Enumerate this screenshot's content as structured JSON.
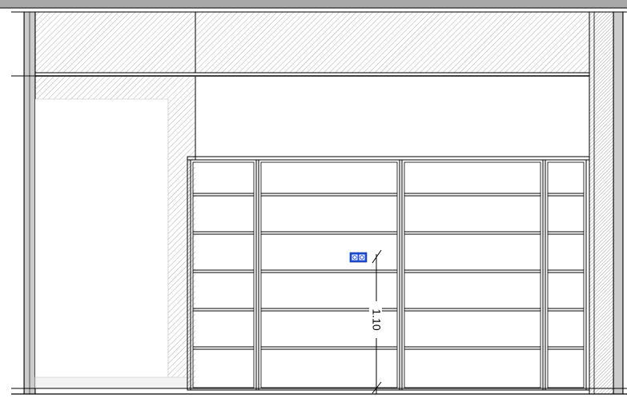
{
  "drawing": {
    "type": "architectural elevation",
    "dimension": {
      "value_label": "1.10"
    },
    "shelving": {
      "columns": 4,
      "shelves_per_column": 5
    },
    "colors": {
      "line": "#000000",
      "frame_top": "#a8a8a8",
      "hatch": "#9a9a9a",
      "dim_marker": "#1f4fd6",
      "background": "#ffffff"
    },
    "icons": {
      "dim_marker": "dimension-handle-icon"
    }
  }
}
